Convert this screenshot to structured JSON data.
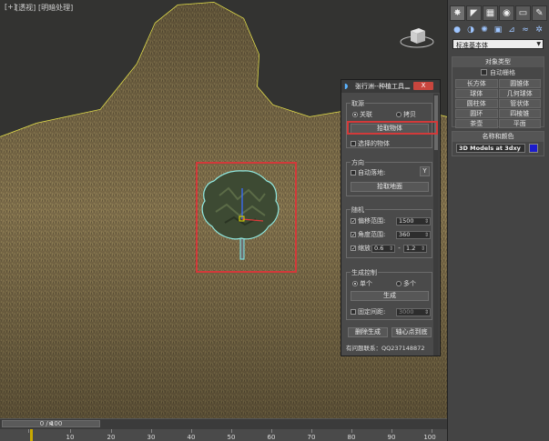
{
  "viewport": {
    "labels": [
      "[+]",
      "[透视]",
      "[明暗处理]"
    ]
  },
  "timeline": {
    "frame_display": "0 / 100",
    "ticks": [
      "10",
      "20",
      "30",
      "40",
      "50",
      "60",
      "70",
      "80",
      "90",
      "100"
    ]
  },
  "command_panel": {
    "dropdown_value": "标准基本体",
    "object_type": {
      "header": "对象类型",
      "autogrid": "自动栅格",
      "buttons": [
        "长方体",
        "圆锥体",
        "球体",
        "几何球体",
        "圆柱体",
        "管状体",
        "圆环",
        "四棱锥",
        "茶壶",
        "平面"
      ]
    },
    "name_color": {
      "header": "名称和颜色",
      "name_value": "3D Models at 3dxy",
      "swatch_color": "#1c1ccc"
    }
  },
  "dialog": {
    "title": "张行洲--种植工具",
    "close_label": "X",
    "source_group": {
      "title": "取源",
      "radio_instance": "关联",
      "radio_copy": "拷贝",
      "pick_button": "拾取物体",
      "selected_check": "选择的物体"
    },
    "direction_group": {
      "title": "方向",
      "auto_ground": "自动落地:",
      "axis_button": "Y",
      "pick_ground_button": "拾取地面"
    },
    "random_group": {
      "title": "随机",
      "offset_label": "偏移范围:",
      "offset_value": "1500",
      "angle_label": "角度范围:",
      "angle_value": "360",
      "scale_label": "缩放",
      "scale_min": "0.6",
      "scale_max": "1.2"
    },
    "generate_group": {
      "title": "生成控制",
      "single": "单个",
      "multiple": "多个",
      "generate_button": "生成",
      "fixed_label": "固定间距:",
      "fixed_value": "3000"
    },
    "delete_button": "删除生成",
    "pivot_button": "轴心点到底",
    "footer": "有问题联系：QQ237148872"
  }
}
